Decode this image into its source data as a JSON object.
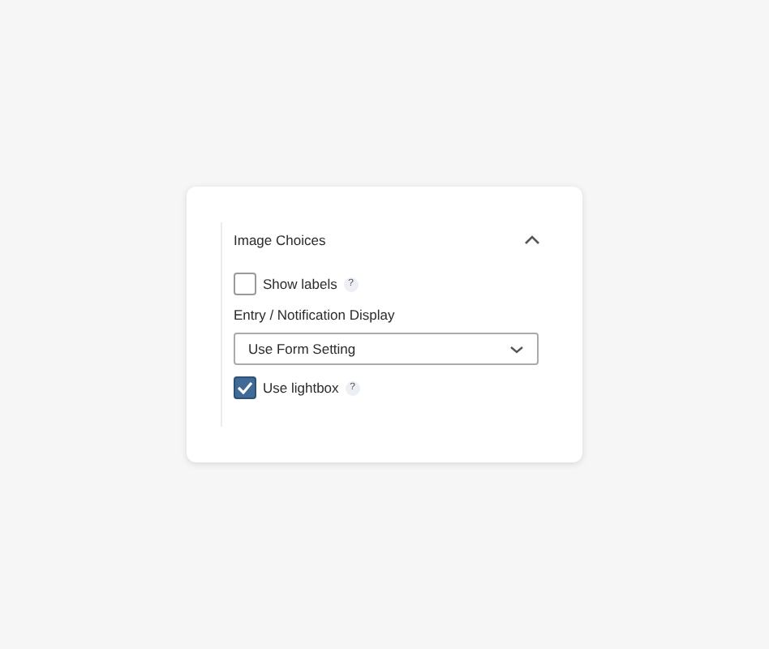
{
  "panel": {
    "title": "Image Choices",
    "expanded": true
  },
  "fields": [
    {
      "kind": "checkbox",
      "label": "Show labels",
      "checked": false,
      "help": "?"
    },
    {
      "kind": "select",
      "label": "Entry / Notification Display",
      "value": "Use Form Setting"
    },
    {
      "kind": "checkbox",
      "label": "Use lightbox",
      "checked": true,
      "help": "?"
    }
  ]
}
